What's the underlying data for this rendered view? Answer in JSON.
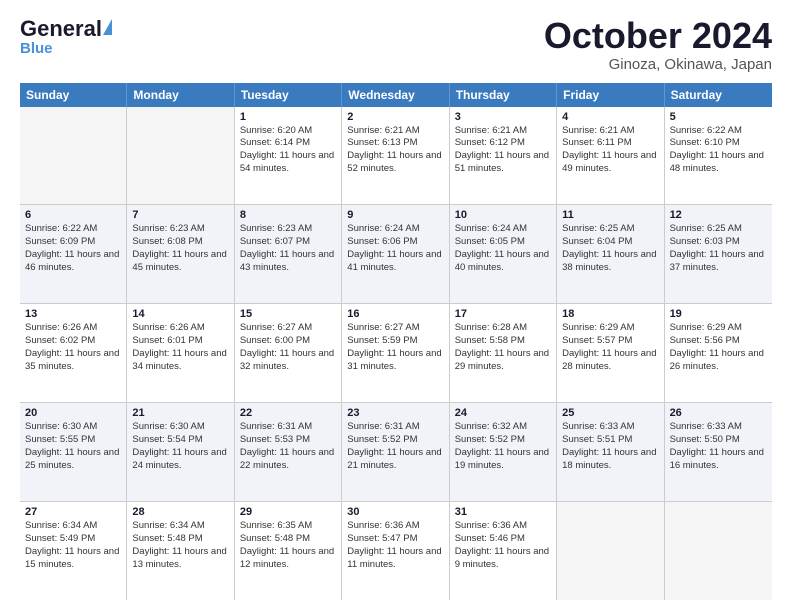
{
  "header": {
    "logo_general": "General",
    "logo_blue": "Blue",
    "title": "October 2024",
    "subtitle": "Ginoza, Okinawa, Japan"
  },
  "days_of_week": [
    "Sunday",
    "Monday",
    "Tuesday",
    "Wednesday",
    "Thursday",
    "Friday",
    "Saturday"
  ],
  "weeks": [
    {
      "alt": false,
      "days": [
        {
          "num": "",
          "sunrise": "",
          "sunset": "",
          "daylight": "",
          "empty": true
        },
        {
          "num": "",
          "sunrise": "",
          "sunset": "",
          "daylight": "",
          "empty": true
        },
        {
          "num": "1",
          "sunrise": "Sunrise: 6:20 AM",
          "sunset": "Sunset: 6:14 PM",
          "daylight": "Daylight: 11 hours and 54 minutes.",
          "empty": false
        },
        {
          "num": "2",
          "sunrise": "Sunrise: 6:21 AM",
          "sunset": "Sunset: 6:13 PM",
          "daylight": "Daylight: 11 hours and 52 minutes.",
          "empty": false
        },
        {
          "num": "3",
          "sunrise": "Sunrise: 6:21 AM",
          "sunset": "Sunset: 6:12 PM",
          "daylight": "Daylight: 11 hours and 51 minutes.",
          "empty": false
        },
        {
          "num": "4",
          "sunrise": "Sunrise: 6:21 AM",
          "sunset": "Sunset: 6:11 PM",
          "daylight": "Daylight: 11 hours and 49 minutes.",
          "empty": false
        },
        {
          "num": "5",
          "sunrise": "Sunrise: 6:22 AM",
          "sunset": "Sunset: 6:10 PM",
          "daylight": "Daylight: 11 hours and 48 minutes.",
          "empty": false
        }
      ]
    },
    {
      "alt": true,
      "days": [
        {
          "num": "6",
          "sunrise": "Sunrise: 6:22 AM",
          "sunset": "Sunset: 6:09 PM",
          "daylight": "Daylight: 11 hours and 46 minutes.",
          "empty": false
        },
        {
          "num": "7",
          "sunrise": "Sunrise: 6:23 AM",
          "sunset": "Sunset: 6:08 PM",
          "daylight": "Daylight: 11 hours and 45 minutes.",
          "empty": false
        },
        {
          "num": "8",
          "sunrise": "Sunrise: 6:23 AM",
          "sunset": "Sunset: 6:07 PM",
          "daylight": "Daylight: 11 hours and 43 minutes.",
          "empty": false
        },
        {
          "num": "9",
          "sunrise": "Sunrise: 6:24 AM",
          "sunset": "Sunset: 6:06 PM",
          "daylight": "Daylight: 11 hours and 41 minutes.",
          "empty": false
        },
        {
          "num": "10",
          "sunrise": "Sunrise: 6:24 AM",
          "sunset": "Sunset: 6:05 PM",
          "daylight": "Daylight: 11 hours and 40 minutes.",
          "empty": false
        },
        {
          "num": "11",
          "sunrise": "Sunrise: 6:25 AM",
          "sunset": "Sunset: 6:04 PM",
          "daylight": "Daylight: 11 hours and 38 minutes.",
          "empty": false
        },
        {
          "num": "12",
          "sunrise": "Sunrise: 6:25 AM",
          "sunset": "Sunset: 6:03 PM",
          "daylight": "Daylight: 11 hours and 37 minutes.",
          "empty": false
        }
      ]
    },
    {
      "alt": false,
      "days": [
        {
          "num": "13",
          "sunrise": "Sunrise: 6:26 AM",
          "sunset": "Sunset: 6:02 PM",
          "daylight": "Daylight: 11 hours and 35 minutes.",
          "empty": false
        },
        {
          "num": "14",
          "sunrise": "Sunrise: 6:26 AM",
          "sunset": "Sunset: 6:01 PM",
          "daylight": "Daylight: 11 hours and 34 minutes.",
          "empty": false
        },
        {
          "num": "15",
          "sunrise": "Sunrise: 6:27 AM",
          "sunset": "Sunset: 6:00 PM",
          "daylight": "Daylight: 11 hours and 32 minutes.",
          "empty": false
        },
        {
          "num": "16",
          "sunrise": "Sunrise: 6:27 AM",
          "sunset": "Sunset: 5:59 PM",
          "daylight": "Daylight: 11 hours and 31 minutes.",
          "empty": false
        },
        {
          "num": "17",
          "sunrise": "Sunrise: 6:28 AM",
          "sunset": "Sunset: 5:58 PM",
          "daylight": "Daylight: 11 hours and 29 minutes.",
          "empty": false
        },
        {
          "num": "18",
          "sunrise": "Sunrise: 6:29 AM",
          "sunset": "Sunset: 5:57 PM",
          "daylight": "Daylight: 11 hours and 28 minutes.",
          "empty": false
        },
        {
          "num": "19",
          "sunrise": "Sunrise: 6:29 AM",
          "sunset": "Sunset: 5:56 PM",
          "daylight": "Daylight: 11 hours and 26 minutes.",
          "empty": false
        }
      ]
    },
    {
      "alt": true,
      "days": [
        {
          "num": "20",
          "sunrise": "Sunrise: 6:30 AM",
          "sunset": "Sunset: 5:55 PM",
          "daylight": "Daylight: 11 hours and 25 minutes.",
          "empty": false
        },
        {
          "num": "21",
          "sunrise": "Sunrise: 6:30 AM",
          "sunset": "Sunset: 5:54 PM",
          "daylight": "Daylight: 11 hours and 24 minutes.",
          "empty": false
        },
        {
          "num": "22",
          "sunrise": "Sunrise: 6:31 AM",
          "sunset": "Sunset: 5:53 PM",
          "daylight": "Daylight: 11 hours and 22 minutes.",
          "empty": false
        },
        {
          "num": "23",
          "sunrise": "Sunrise: 6:31 AM",
          "sunset": "Sunset: 5:52 PM",
          "daylight": "Daylight: 11 hours and 21 minutes.",
          "empty": false
        },
        {
          "num": "24",
          "sunrise": "Sunrise: 6:32 AM",
          "sunset": "Sunset: 5:52 PM",
          "daylight": "Daylight: 11 hours and 19 minutes.",
          "empty": false
        },
        {
          "num": "25",
          "sunrise": "Sunrise: 6:33 AM",
          "sunset": "Sunset: 5:51 PM",
          "daylight": "Daylight: 11 hours and 18 minutes.",
          "empty": false
        },
        {
          "num": "26",
          "sunrise": "Sunrise: 6:33 AM",
          "sunset": "Sunset: 5:50 PM",
          "daylight": "Daylight: 11 hours and 16 minutes.",
          "empty": false
        }
      ]
    },
    {
      "alt": false,
      "days": [
        {
          "num": "27",
          "sunrise": "Sunrise: 6:34 AM",
          "sunset": "Sunset: 5:49 PM",
          "daylight": "Daylight: 11 hours and 15 minutes.",
          "empty": false
        },
        {
          "num": "28",
          "sunrise": "Sunrise: 6:34 AM",
          "sunset": "Sunset: 5:48 PM",
          "daylight": "Daylight: 11 hours and 13 minutes.",
          "empty": false
        },
        {
          "num": "29",
          "sunrise": "Sunrise: 6:35 AM",
          "sunset": "Sunset: 5:48 PM",
          "daylight": "Daylight: 11 hours and 12 minutes.",
          "empty": false
        },
        {
          "num": "30",
          "sunrise": "Sunrise: 6:36 AM",
          "sunset": "Sunset: 5:47 PM",
          "daylight": "Daylight: 11 hours and 11 minutes.",
          "empty": false
        },
        {
          "num": "31",
          "sunrise": "Sunrise: 6:36 AM",
          "sunset": "Sunset: 5:46 PM",
          "daylight": "Daylight: 11 hours and 9 minutes.",
          "empty": false
        },
        {
          "num": "",
          "sunrise": "",
          "sunset": "",
          "daylight": "",
          "empty": true
        },
        {
          "num": "",
          "sunrise": "",
          "sunset": "",
          "daylight": "",
          "empty": true
        }
      ]
    }
  ]
}
